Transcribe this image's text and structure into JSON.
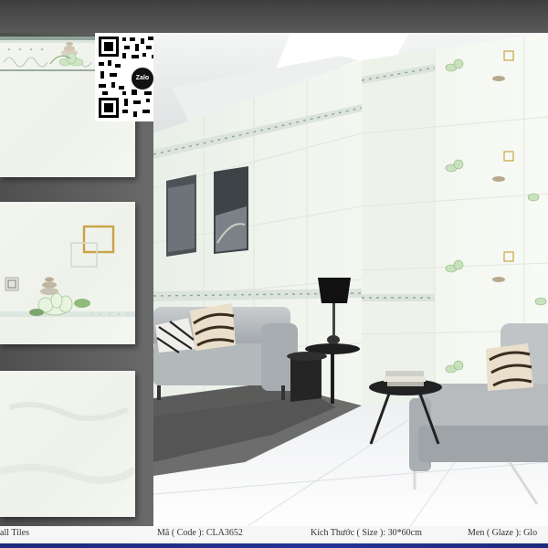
{
  "qr": {
    "logo_text": "Zalo",
    "icon": "qr-code-icon"
  },
  "footer": {
    "category": "all Tiles",
    "code": "Mã ( Code ): CLA3652",
    "size": "Kích Thước ( Size ): 30*60cm",
    "glaze": "Men ( Glaze ): Glo"
  },
  "colors": {
    "frame_dark": "#4f4f4f",
    "tile_base": "#f1f4ec",
    "accent_gold": "#c9a447",
    "footer_bar": "#243496"
  }
}
